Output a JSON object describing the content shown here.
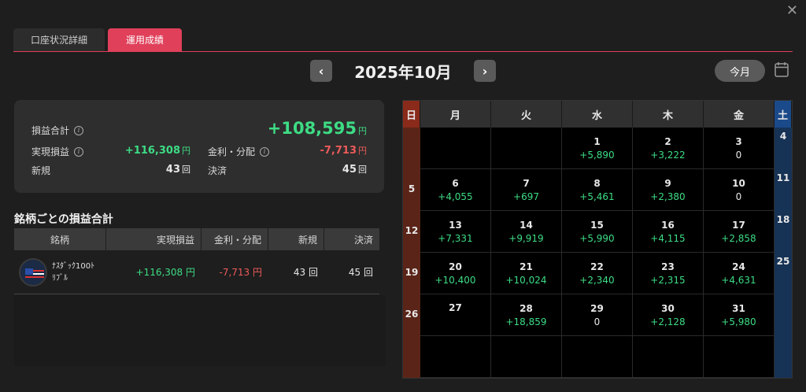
{
  "window": {
    "close_label": "✕"
  },
  "tabs": [
    {
      "label": "口座状況詳細",
      "active": false
    },
    {
      "label": "運用成績",
      "active": true
    }
  ],
  "month_nav": {
    "prev": "‹",
    "title": "2025年10月",
    "next": "›",
    "today": "今月"
  },
  "summary": {
    "total_label": "損益合計",
    "total_value": "+108,595",
    "total_unit": "円",
    "realized_label": "実現損益",
    "realized_value": "+116,308",
    "realized_unit": "円",
    "interest_label": "金利・分配",
    "interest_value": "-7,713",
    "interest_unit": "円",
    "new_label": "新規",
    "new_value": "43",
    "new_unit": "回",
    "settle_label": "決済",
    "settle_value": "45",
    "settle_unit": "回"
  },
  "by_symbol": {
    "title": "銘柄ごとの損益合計",
    "headers": [
      "銘柄",
      "実現損益",
      "金利・分配",
      "新規",
      "決済"
    ],
    "rows": [
      {
        "name_line1": "ﾅｽﾀﾞｯｸ100ﾄ",
        "name_line2": "ﾘﾌﾞﾙ",
        "realized": "+116,308 円",
        "interest": "-7,713 円",
        "new": "43 回",
        "settle": "45 回"
      }
    ]
  },
  "calendar": {
    "weekdays": [
      "日",
      "月",
      "火",
      "水",
      "木",
      "金",
      "土"
    ],
    "sundays": [
      "",
      "5",
      "12",
      "19",
      "26",
      ""
    ],
    "saturdays": [
      "4",
      "11",
      "18",
      "25",
      "",
      ""
    ],
    "weeks": [
      [
        {
          "d": "",
          "pl": ""
        },
        {
          "d": "",
          "pl": ""
        },
        {
          "d": "1",
          "pl": "+5,890"
        },
        {
          "d": "2",
          "pl": "+3,222"
        },
        {
          "d": "3",
          "pl": "0"
        }
      ],
      [
        {
          "d": "6",
          "pl": "+4,055"
        },
        {
          "d": "7",
          "pl": "+697"
        },
        {
          "d": "8",
          "pl": "+5,461"
        },
        {
          "d": "9",
          "pl": "+2,380"
        },
        {
          "d": "10",
          "pl": "0"
        }
      ],
      [
        {
          "d": "13",
          "pl": "+7,331"
        },
        {
          "d": "14",
          "pl": "+9,919"
        },
        {
          "d": "15",
          "pl": "+5,990"
        },
        {
          "d": "16",
          "pl": "+4,115"
        },
        {
          "d": "17",
          "pl": "+2,858"
        }
      ],
      [
        {
          "d": "20",
          "pl": "+10,400"
        },
        {
          "d": "21",
          "pl": "+10,024"
        },
        {
          "d": "22",
          "pl": "+2,340"
        },
        {
          "d": "23",
          "pl": "+2,315"
        },
        {
          "d": "24",
          "pl": "+4,631"
        }
      ],
      [
        {
          "d": "27",
          "pl": ""
        },
        {
          "d": "28",
          "pl": "+18,859"
        },
        {
          "d": "29",
          "pl": "0"
        },
        {
          "d": "30",
          "pl": "+2,128"
        },
        {
          "d": "31",
          "pl": "+5,980"
        }
      ],
      [
        {
          "d": "",
          "pl": ""
        },
        {
          "d": "",
          "pl": ""
        },
        {
          "d": "",
          "pl": ""
        },
        {
          "d": "",
          "pl": ""
        },
        {
          "d": "",
          "pl": ""
        }
      ]
    ]
  },
  "colors": {
    "accent": "#e0405a",
    "profit": "#3ddc84",
    "loss": "#ee5a5a",
    "sunday": "#8a2a1a",
    "saturday": "#1b4a8a"
  }
}
